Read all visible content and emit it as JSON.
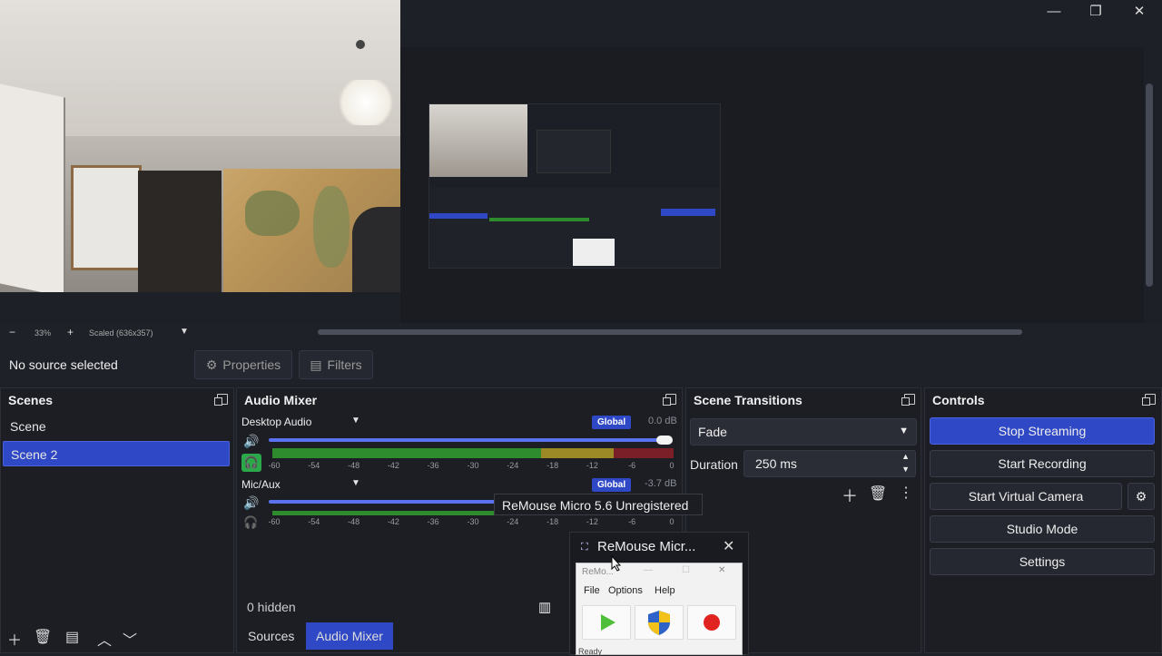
{
  "window": {
    "minimize": "—",
    "maximize": "❐",
    "close": "✕"
  },
  "preview": {
    "zoom_minus": "−",
    "zoom_level": "33%",
    "zoom_plus": "+",
    "scale_label": "Scaled (636x357)"
  },
  "context_bar": {
    "no_source": "No source selected",
    "properties": "Properties",
    "filters": "Filters"
  },
  "scenes": {
    "title": "Scenes",
    "items": [
      {
        "label": "Scene",
        "selected": false
      },
      {
        "label": "Scene 2",
        "selected": true
      }
    ]
  },
  "mixer": {
    "title": "Audio Mixer",
    "tick_labels": [
      "-60",
      "-54",
      "-48",
      "-42",
      "-36",
      "-30",
      "-24",
      "-18",
      "-12",
      "-6",
      "0"
    ],
    "channels": [
      {
        "name": "Desktop Audio",
        "badge": "Global",
        "db": "0.0 dB",
        "volume": 1.0
      },
      {
        "name": "Mic/Aux",
        "badge": "Global",
        "db": "-3.7 dB",
        "volume": 0.57
      }
    ],
    "hidden_label": "0 hidden"
  },
  "tabs": {
    "sources": "Sources",
    "audio_mixer": "Audio Mixer"
  },
  "transitions": {
    "title": "Scene Transitions",
    "selected": "Fade",
    "duration_label": "Duration",
    "duration_value": "250 ms"
  },
  "controls": {
    "title": "Controls",
    "stop_streaming": "Stop Streaming",
    "start_recording": "Start Recording",
    "start_virtual_camera": "Start Virtual Camera",
    "studio_mode": "Studio Mode",
    "settings": "Settings"
  },
  "tooltip": {
    "text": "ReMouse Micro 5.6 Unregistered"
  },
  "remouse": {
    "taskbar_title": "ReMouse Micr...",
    "inner_title": "ReMo...",
    "menu": [
      "File",
      "Options",
      "Help"
    ],
    "status": "Ready"
  },
  "colors": {
    "accent": "#2f48c5",
    "meter_green": "#2e8b2e",
    "meter_yellow": "#9b8a26",
    "meter_red": "#7a1e28",
    "headphone_green": "#2aa84a"
  }
}
